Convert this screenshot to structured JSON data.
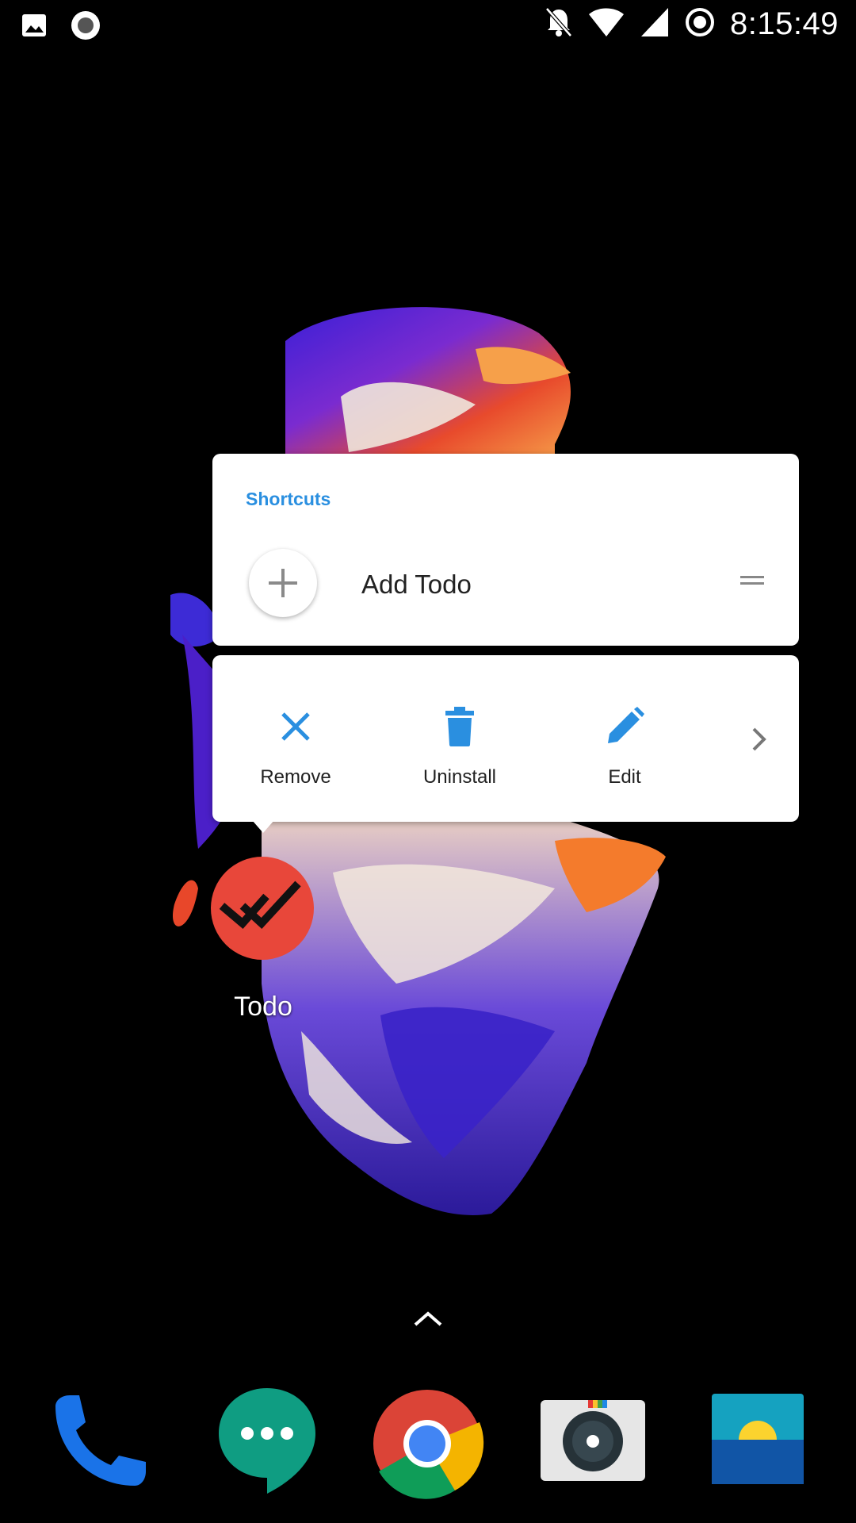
{
  "status_bar": {
    "time": "8:15:49",
    "left_icons": [
      "image-notification-icon",
      "record-notification-icon"
    ],
    "right_icons": [
      "notifications-muted-icon",
      "wifi-icon",
      "cell-signal-icon",
      "do-not-disturb-icon"
    ]
  },
  "popup": {
    "shortcuts_title": "Shortcuts",
    "shortcut": {
      "label": "Add Todo",
      "icon": "plus-icon"
    },
    "actions": [
      {
        "label": "Remove",
        "icon": "close-icon"
      },
      {
        "label": "Uninstall",
        "icon": "trash-icon"
      },
      {
        "label": "Edit",
        "icon": "pencil-icon"
      }
    ],
    "more_icon": "chevron-right-icon"
  },
  "home": {
    "app_label": "Todo",
    "app_icon": "double-check-icon",
    "drawer_icon": "chevron-up-icon"
  },
  "dock": [
    "phone-app",
    "hangouts-app",
    "chrome-app",
    "camera-app",
    "gallery-app"
  ],
  "colors": {
    "accent": "#2a8fe0",
    "todo_icon": "#e8473a"
  }
}
